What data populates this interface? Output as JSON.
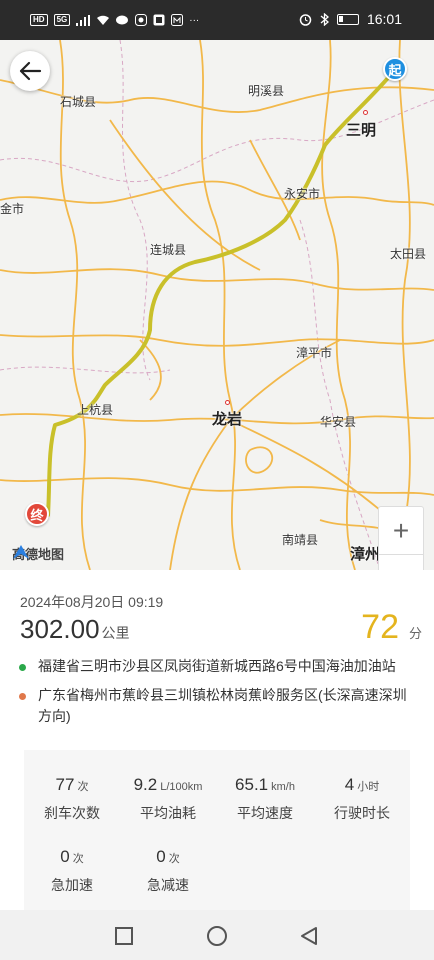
{
  "status_bar": {
    "left_chips": [
      "HD",
      "5G"
    ],
    "time": "16:01",
    "icons": [
      "signal-icon",
      "wifi-icon",
      "wechat-icon",
      "app-icon",
      "app-icon",
      "app-icon",
      "more-dots-icon",
      "alarm-icon",
      "bluetooth-icon",
      "battery-icon"
    ]
  },
  "map": {
    "logo_text": "高德地图",
    "start_marker": "起",
    "end_marker": "终",
    "zoom_in": "+",
    "zoom_out": "−",
    "cities": [
      {
        "name": "明溪县",
        "big": false
      },
      {
        "name": "三明",
        "big": true
      },
      {
        "name": "石城县",
        "big": false
      },
      {
        "name": "永安市",
        "big": false
      },
      {
        "name": "金市",
        "big": false
      },
      {
        "name": "连城县",
        "big": false
      },
      {
        "name": "太田县",
        "big": false
      },
      {
        "name": "漳平市",
        "big": false
      },
      {
        "name": "上杭县",
        "big": false
      },
      {
        "name": "龙岩",
        "big": true
      },
      {
        "name": "华安县",
        "big": false
      },
      {
        "name": "南靖县",
        "big": false
      },
      {
        "name": "漳州",
        "big": true
      }
    ]
  },
  "trip": {
    "date": "2024年08月20日 09:19",
    "distance": "302.00",
    "distance_unit": "公里",
    "score": "72",
    "score_unit": "分",
    "start_location": "福建省三明市沙县区凤岗街道新城西路6号中国海油加油站",
    "end_location": "广东省梅州市蕉岭县三圳镇松林岗蕉岭服务区(长深高速深圳方向)",
    "start_color": "#2aa84a",
    "end_color": "#e0784a"
  },
  "stats": [
    {
      "value": "77",
      "unit": "次",
      "label": "刹车次数"
    },
    {
      "value": "9.2",
      "unit": "L/100km",
      "label": "平均油耗"
    },
    {
      "value": "65.1",
      "unit": "km/h",
      "label": "平均速度"
    },
    {
      "value": "4",
      "unit": "小时",
      "label": "行驶时长"
    },
    {
      "value": "0",
      "unit": "次",
      "label": "急加速"
    },
    {
      "value": "0",
      "unit": "次",
      "label": "急减速"
    }
  ],
  "colors": {
    "route": "#c9c02a",
    "road": "#f2b84a",
    "start": "#1e8fe0",
    "end": "#e2483a",
    "score": "#e4b41e"
  }
}
